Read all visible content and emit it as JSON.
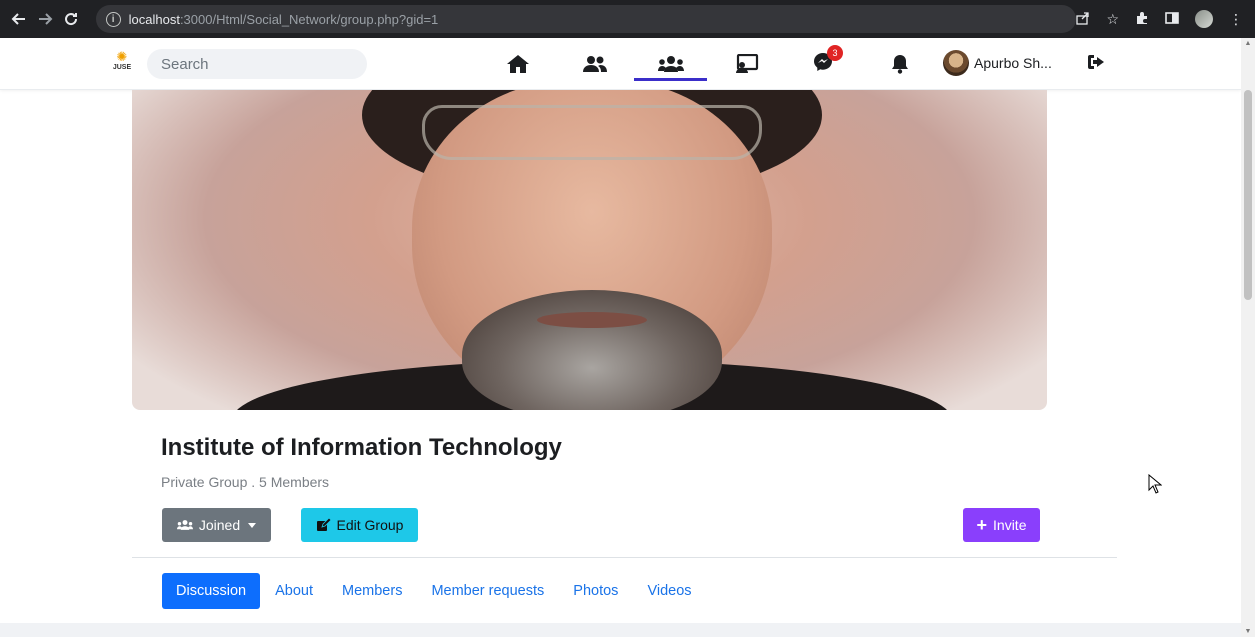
{
  "browser": {
    "url_host": "localhost",
    "url_rest": ":3000/Html/Social_Network/group.php?gid=1",
    "back_icon": "arrow-left-icon",
    "forward_icon": "arrow-right-icon",
    "reload_icon": "reload-icon"
  },
  "header": {
    "logo_text": "JUSE",
    "search_placeholder": "Search",
    "nav": [
      {
        "name": "home",
        "icon": "home-icon"
      },
      {
        "name": "friends",
        "icon": "friends-icon"
      },
      {
        "name": "groups",
        "icon": "groups-icon",
        "active": true
      },
      {
        "name": "watch",
        "icon": "screen-icon"
      },
      {
        "name": "messenger",
        "icon": "messenger-icon",
        "badge": "3"
      },
      {
        "name": "notifications",
        "icon": "bell-icon"
      }
    ],
    "profile_name": "Apurbo Sh...",
    "active_color": "#3b2ec9"
  },
  "group": {
    "title": "Institute of Information Technology",
    "meta": "Private Group . 5 Members",
    "joined_label": "Joined",
    "edit_label": "Edit Group",
    "invite_label": "Invite"
  },
  "tabs": [
    "Discussion",
    "About",
    "Members",
    "Member requests",
    "Photos",
    "Videos"
  ],
  "active_tab": "Discussion",
  "colors": {
    "joined_btn": "#6c757d",
    "edit_btn": "#1ec8e8",
    "invite_btn": "#8a3ffc",
    "tab_active": "#0d6efd",
    "link": "#1a73e8"
  }
}
